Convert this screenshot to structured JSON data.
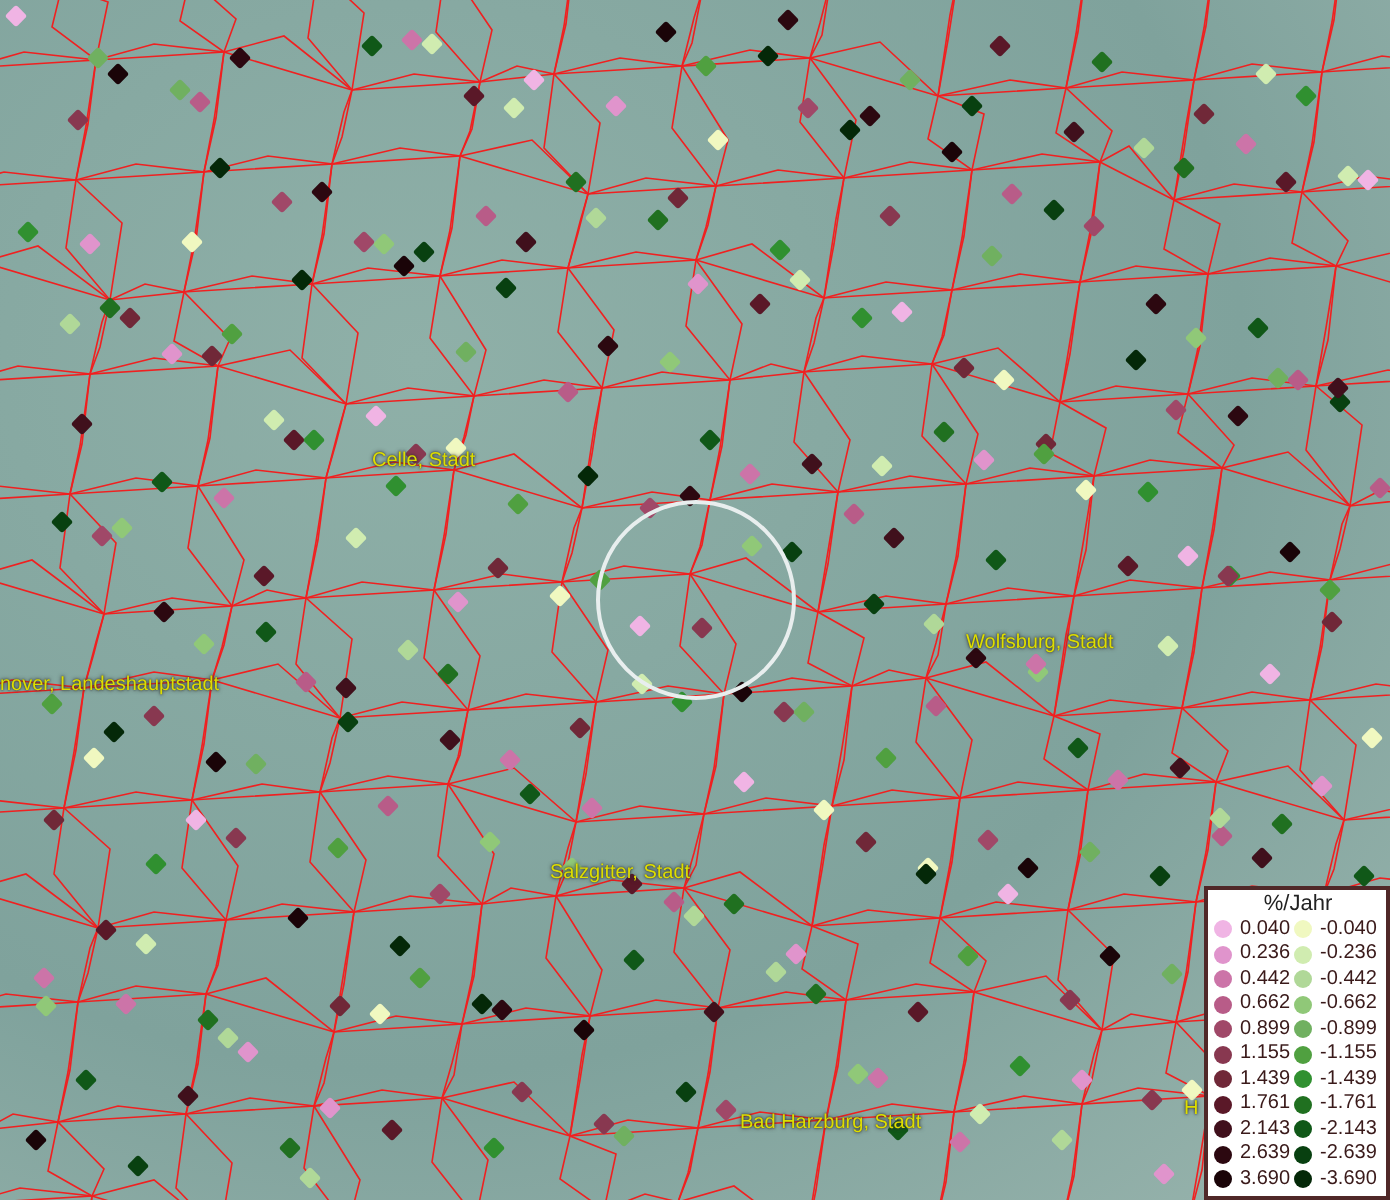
{
  "map": {
    "places": [
      {
        "name": "Celle, Stadt"
      },
      {
        "name": "nover, Landeshauptstadt"
      },
      {
        "name": "Wolfsburg, Stadt"
      },
      {
        "name": "Salzgitter, Stadt"
      },
      {
        "name": "Bad Harzburg, Stadt"
      },
      {
        "name": "H"
      }
    ]
  },
  "legend": {
    "title": "%/Jahr",
    "positive": [
      {
        "label": "0.040",
        "color": "#f0b4e4"
      },
      {
        "label": "0.236",
        "color": "#e094cc"
      },
      {
        "label": "0.442",
        "color": "#cc74a8"
      },
      {
        "label": "0.662",
        "color": "#b85c88"
      },
      {
        "label": "0.899",
        "color": "#a04868"
      },
      {
        "label": "1.155",
        "color": "#883850"
      },
      {
        "label": "1.439",
        "color": "#702838"
      },
      {
        "label": "1.761",
        "color": "#5a1828"
      },
      {
        "label": "2.143",
        "color": "#40101c"
      },
      {
        "label": "2.639",
        "color": "#2c0810"
      },
      {
        "label": "3.690",
        "color": "#1a0408"
      }
    ],
    "negative": [
      {
        "label": "-0.040",
        "color": "#f0f8c0"
      },
      {
        "label": "-0.236",
        "color": "#d0ecb0"
      },
      {
        "label": "-0.442",
        "color": "#b0d898"
      },
      {
        "label": "-0.662",
        "color": "#90c878"
      },
      {
        "label": "-0.899",
        "color": "#70b060"
      },
      {
        "label": "-1.155",
        "color": "#50a040"
      },
      {
        "label": "-1.439",
        "color": "#309030"
      },
      {
        "label": "-1.761",
        "color": "#207020"
      },
      {
        "label": "-2.143",
        "color": "#105818"
      },
      {
        "label": "-2.639",
        "color": "#084010"
      },
      {
        "label": "-3.690",
        "color": "#042808"
      }
    ]
  }
}
